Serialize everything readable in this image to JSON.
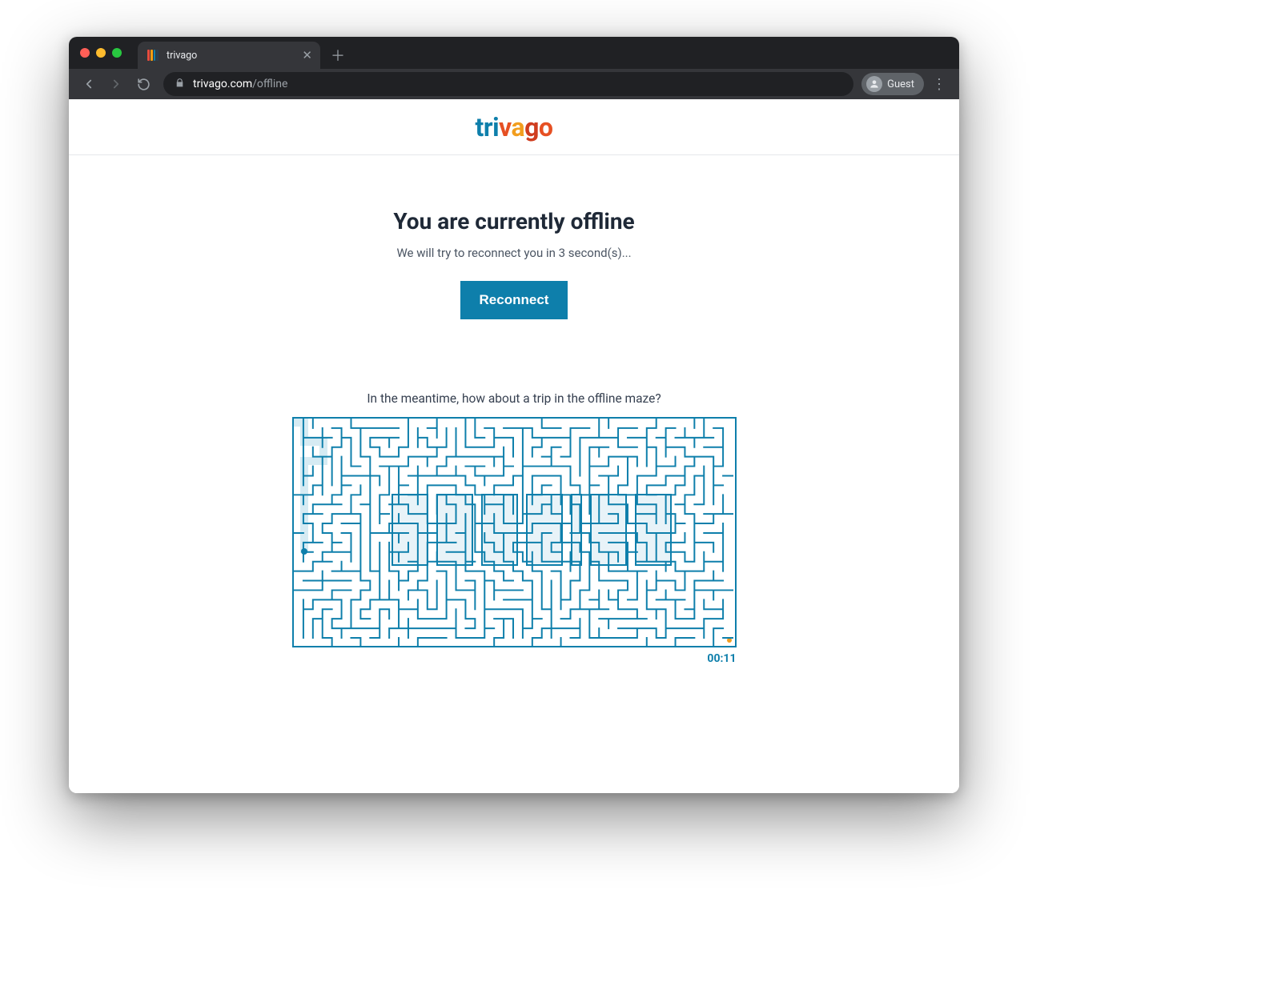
{
  "browser": {
    "tab_title": "trivago",
    "url_host": "trivago.com",
    "url_path": "/offline",
    "guest_label": "Guest"
  },
  "brand": {
    "name": "trivago"
  },
  "offline": {
    "title": "You are currently offline",
    "countdown_seconds": 3,
    "subtitle_template": "We will try to reconnect you in {n} second(s)...",
    "reconnect_label": "Reconnect"
  },
  "maze": {
    "caption": "In the meantime, how about a trip in the offline maze?",
    "overlay_word": "OFFLINE",
    "timer": "00:11"
  }
}
